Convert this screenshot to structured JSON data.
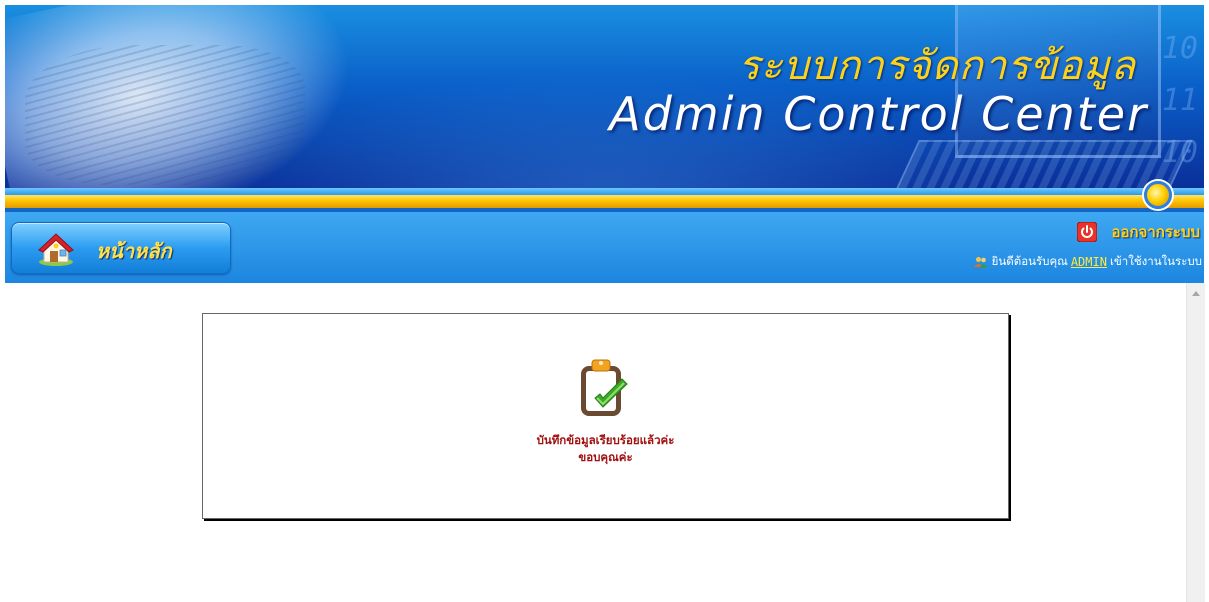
{
  "banner": {
    "thai_title": "ระบบการจัดการข้อมูล",
    "english_title": "Admin Control Center",
    "digits": "10\n11\n10"
  },
  "nav": {
    "home_label": "หน้าหลัก",
    "home_icon": "home-icon",
    "logout_label": "ออกจากระบบ",
    "logout_icon": "power-icon",
    "welcome_prefix": "ยินดีต้อนรับคุณ",
    "username": "ADMIN",
    "welcome_suffix": "เข้าใช้งานในระบบ",
    "users_icon": "users-icon"
  },
  "message": {
    "icon": "clipboard-check-icon",
    "line1": "บันทึกข้อมูลเรียบร้อยแล้วค่ะ",
    "line2": "ขอบคุณค่ะ"
  },
  "colors": {
    "banner_blue": "#0a5fc8",
    "gold": "#ffc400",
    "nav_blue": "#1c86e0",
    "message_text": "#a01010",
    "title_yellow": "#ffd21a"
  }
}
